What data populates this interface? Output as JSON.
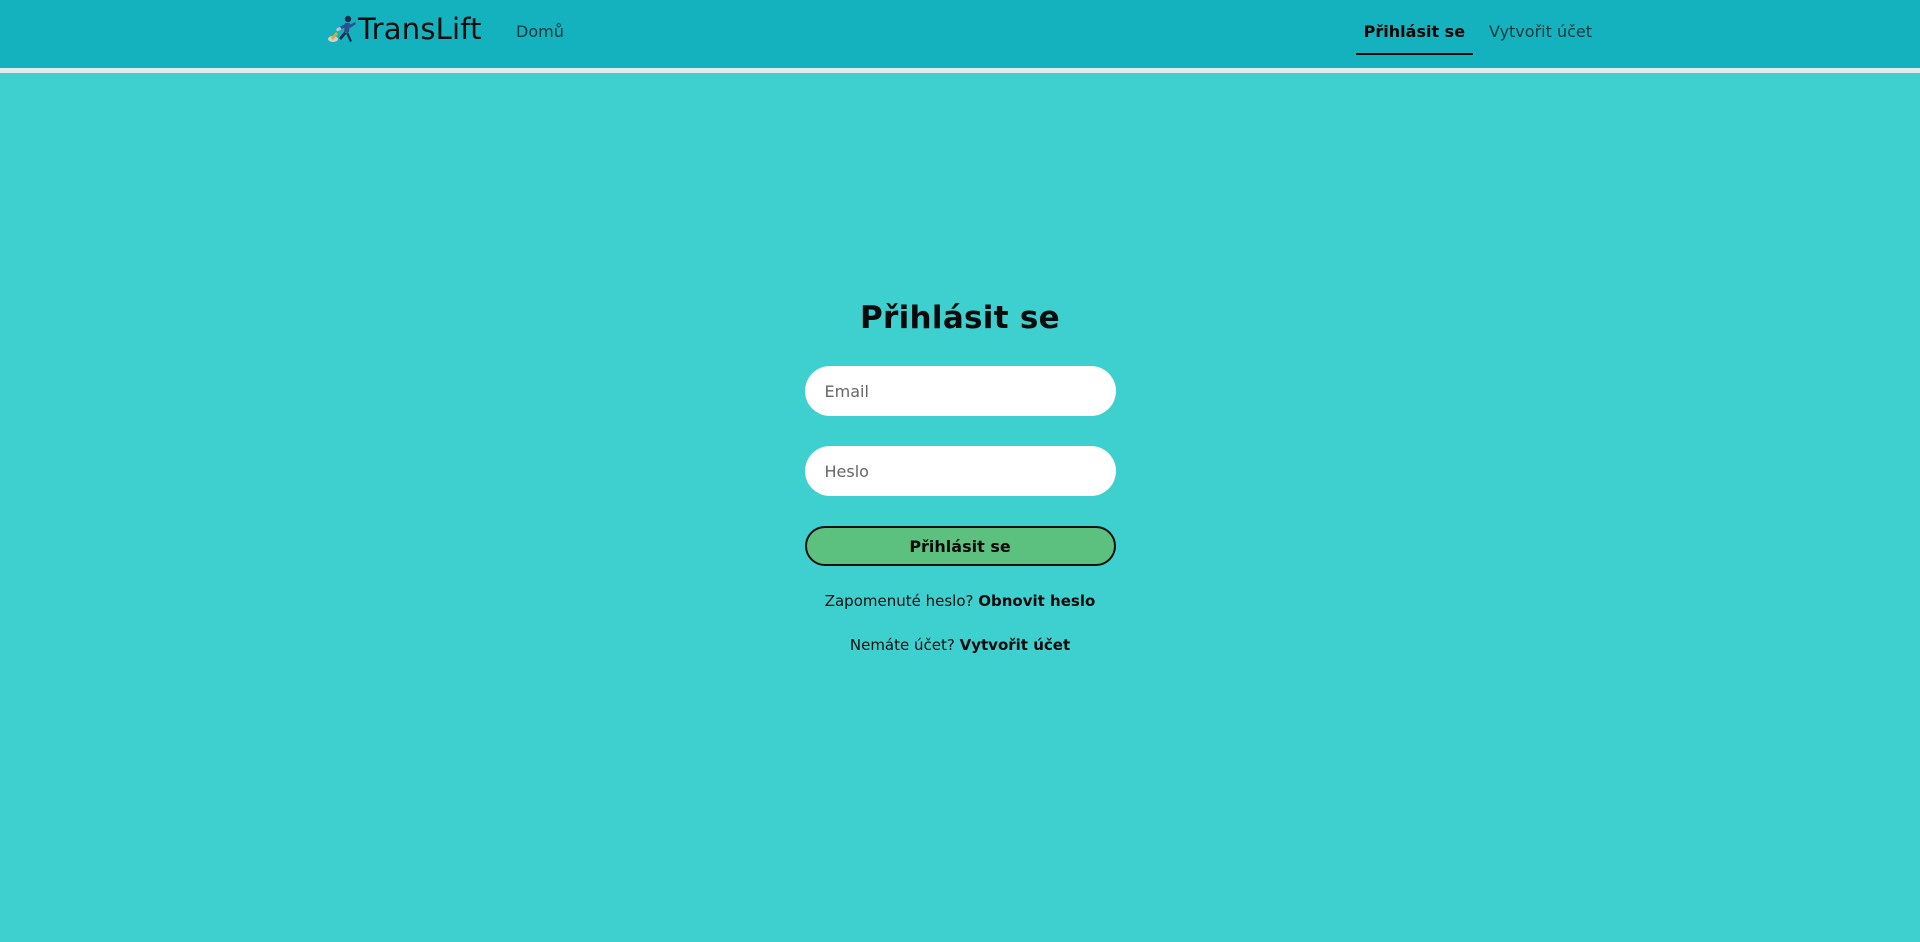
{
  "navbar": {
    "brand_name": "TransLift",
    "brand_logo_icon": "runner-rocket-icon",
    "home_label": "Domů",
    "login_label": "Přihlásit se",
    "register_label": "Vytvořit účet",
    "active_item": "login"
  },
  "login": {
    "title": "Přihlásit se",
    "email_placeholder": "Email",
    "email_value": "",
    "password_placeholder": "Heslo",
    "password_value": "",
    "submit_label": "Přihlásit se",
    "forgot_prefix": "Zapomenuté heslo?",
    "forgot_link": "Obnovit heslo",
    "no_account_prefix": "Nemáte účet?",
    "no_account_link": "Vytvořit účet"
  },
  "colors": {
    "page_background": "#3ecfcf",
    "navbar_background": "#14b2be",
    "submit_button": "#5cc07f",
    "input_background": "#ffffff"
  }
}
